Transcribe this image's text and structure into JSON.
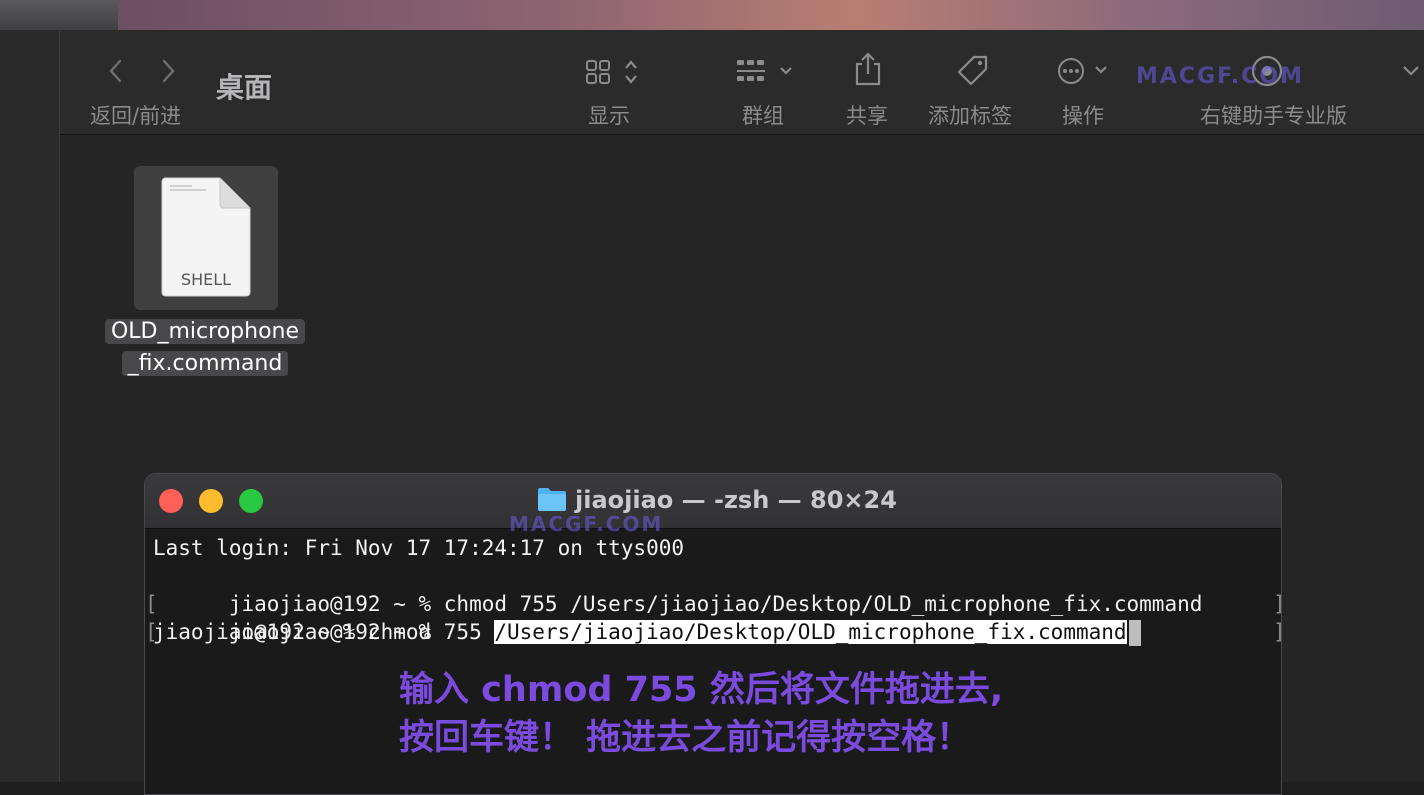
{
  "finder": {
    "title": "桌面",
    "toolbar": {
      "back_forward_label": "返回/前进",
      "view_label": "显示",
      "group_label": "群组",
      "share_label": "共享",
      "tag_label": "添加标签",
      "action_label": "操作",
      "assistant_label": "右键助手专业版"
    },
    "watermark": "MACGF.COM"
  },
  "file": {
    "type_badge": "SHELL",
    "name_line1": "OLD_microphone",
    "name_line2": "_fix.command"
  },
  "terminal": {
    "title": "jiaojiao — -zsh — 80×24",
    "lines": [
      "Last login: Fri Nov 17 17:24:17 on ttys000",
      "jiaojiao@192 ~ % chmod 755 /Users/jiaojiao/Desktop/OLD_microphone_fix.command",
      "jiaojiao@192 ~ %",
      "jiaojiao@192 ~ % chmod 755 "
    ],
    "selected_path": "/Users/jiaojiao/Desktop/OLD_microphone_fix.command",
    "watermark": "MACGF.COM",
    "note_line1": "输入 chmod 755 然后将文件拖进去,",
    "note_line2": "按回车键！ 拖进去之前记得按空格！"
  },
  "colors": {
    "close": "#fe5f57",
    "minimize": "#febc2e",
    "zoom": "#28c840",
    "note": "#7b4bdf",
    "folder": "#4fb2f0"
  }
}
